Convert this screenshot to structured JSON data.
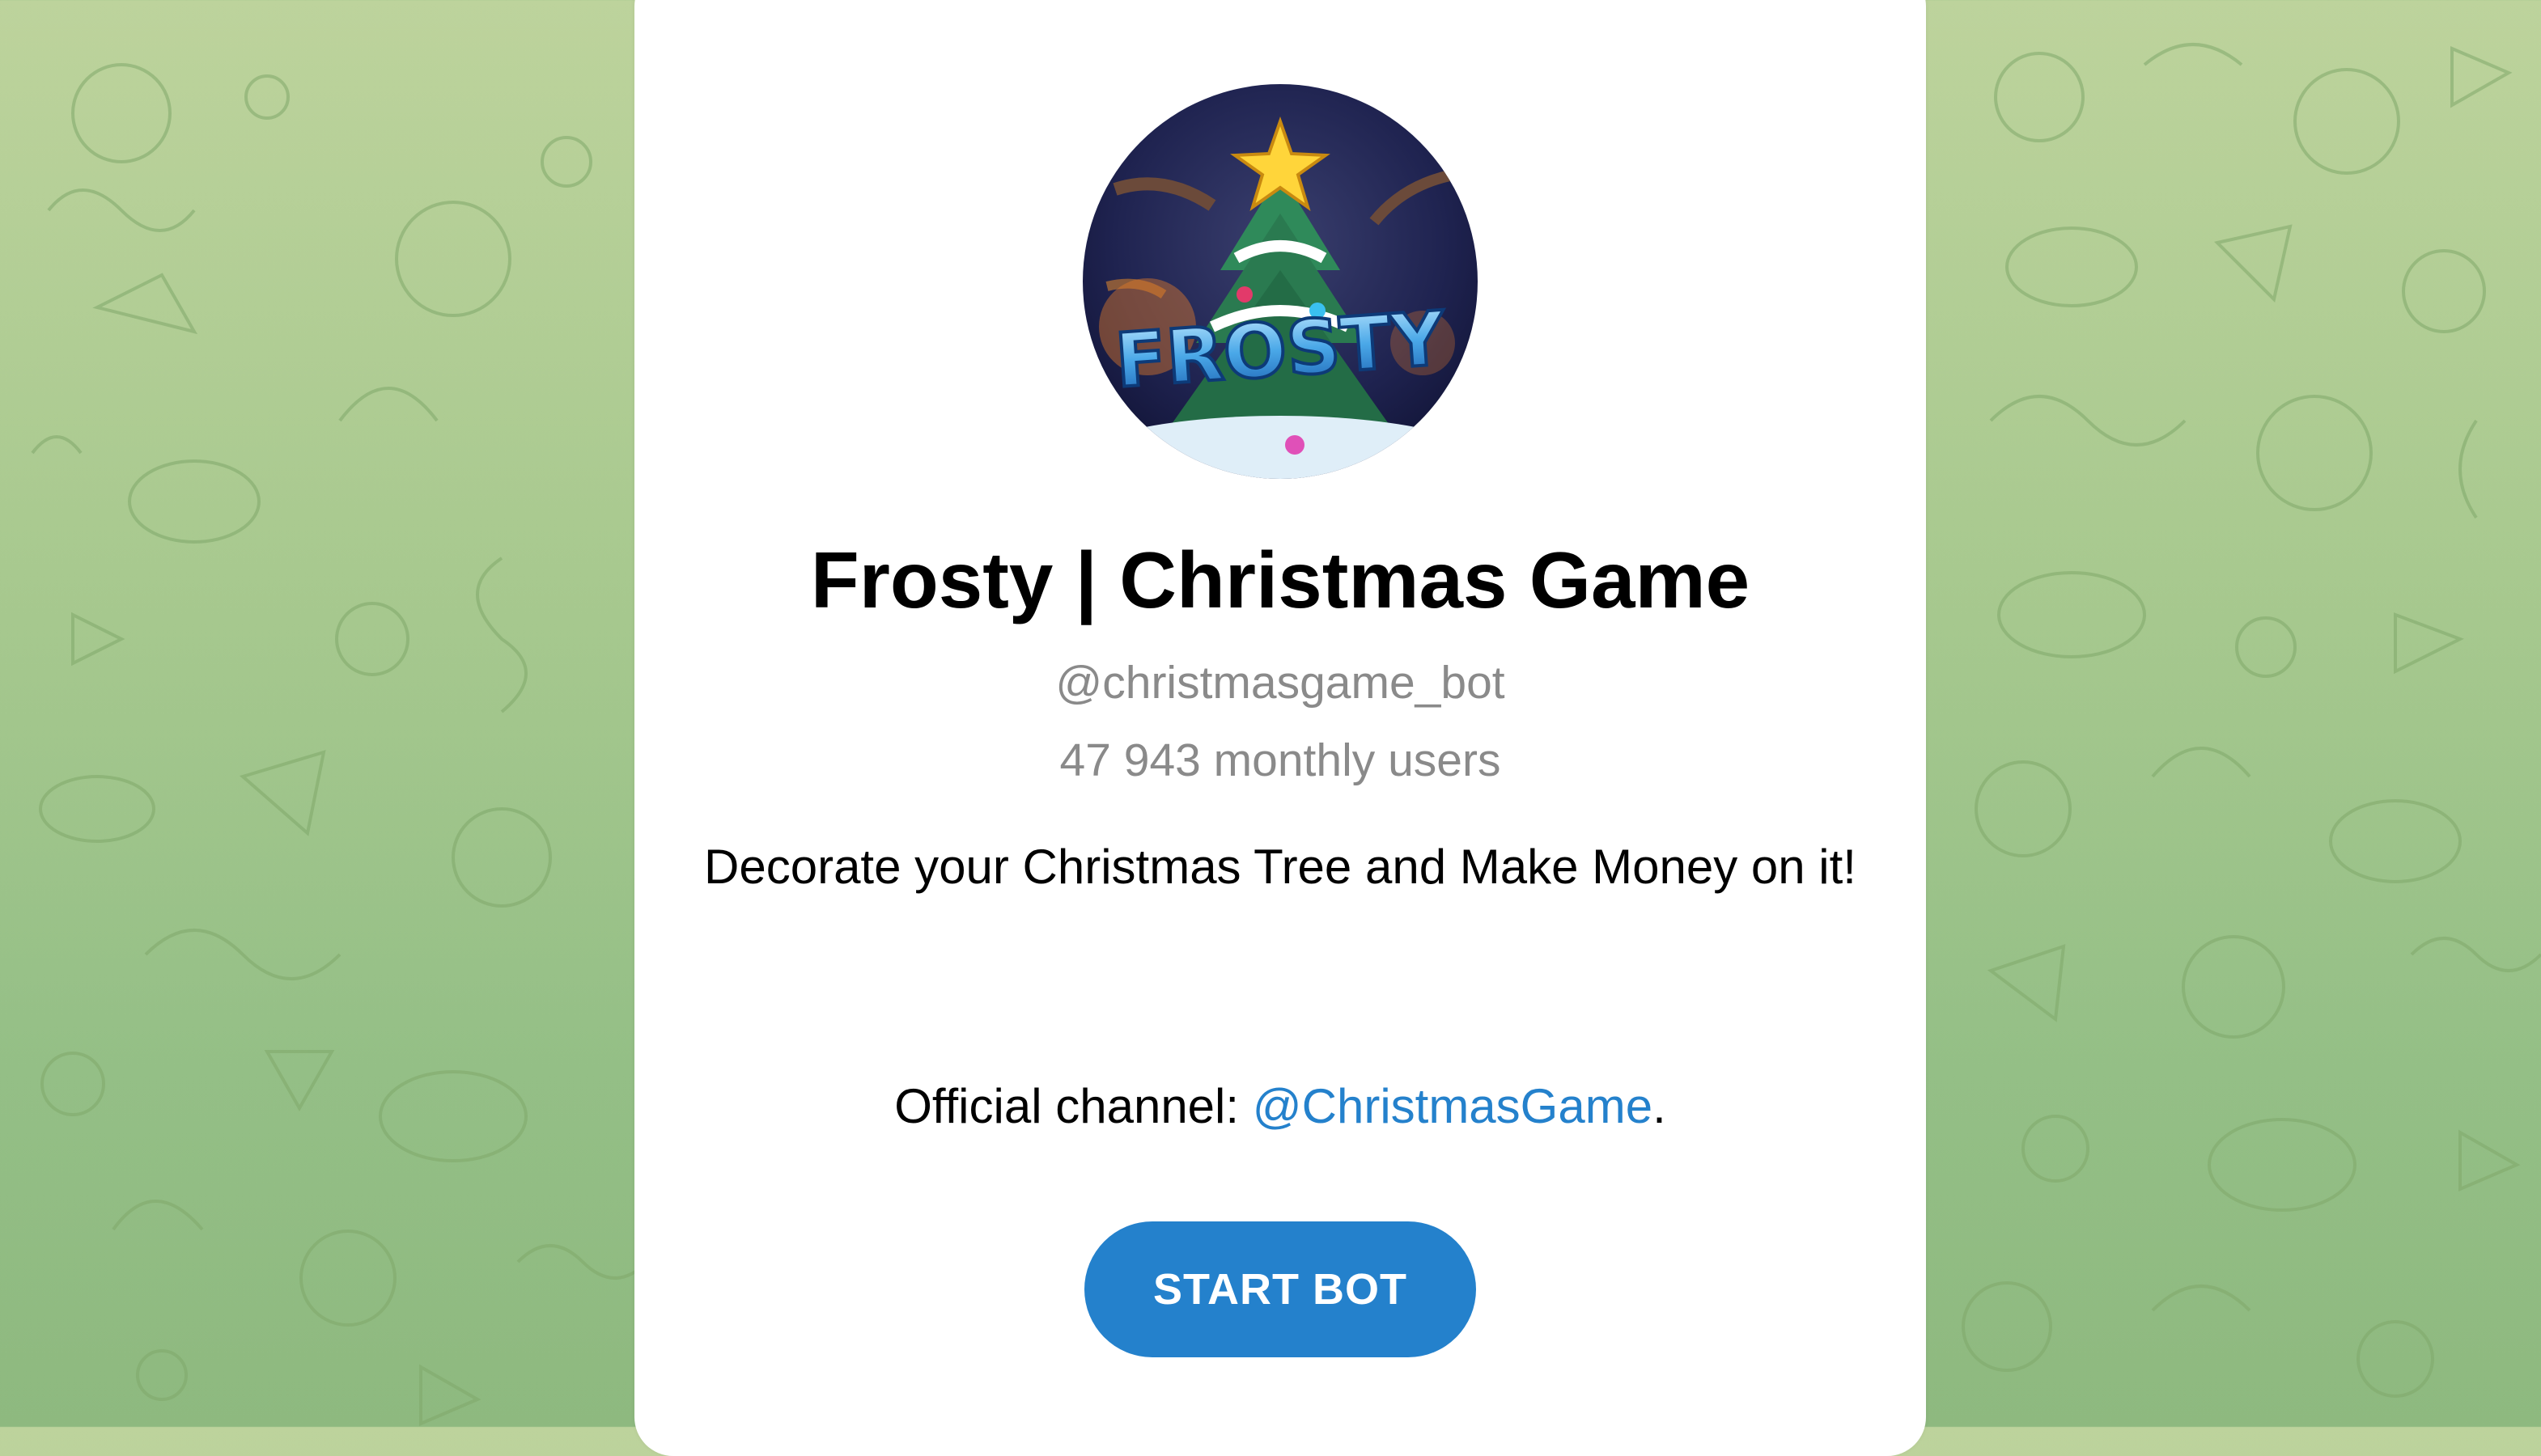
{
  "bot": {
    "name": "Frosty | Christmas Game",
    "username": "@christmasgame_bot",
    "monthly_users": "47 943 monthly users",
    "description": "Decorate your Christmas Tree and Make Money on it!",
    "channel_prefix": "Official channel: ",
    "channel_link": "@ChristmasGame",
    "channel_suffix": ".",
    "avatar_text": "FROSTY"
  },
  "actions": {
    "start_label": "START BOT"
  },
  "colors": {
    "accent": "#2481cc",
    "background": "#a8c98f",
    "muted_text": "#8a8a8a"
  }
}
